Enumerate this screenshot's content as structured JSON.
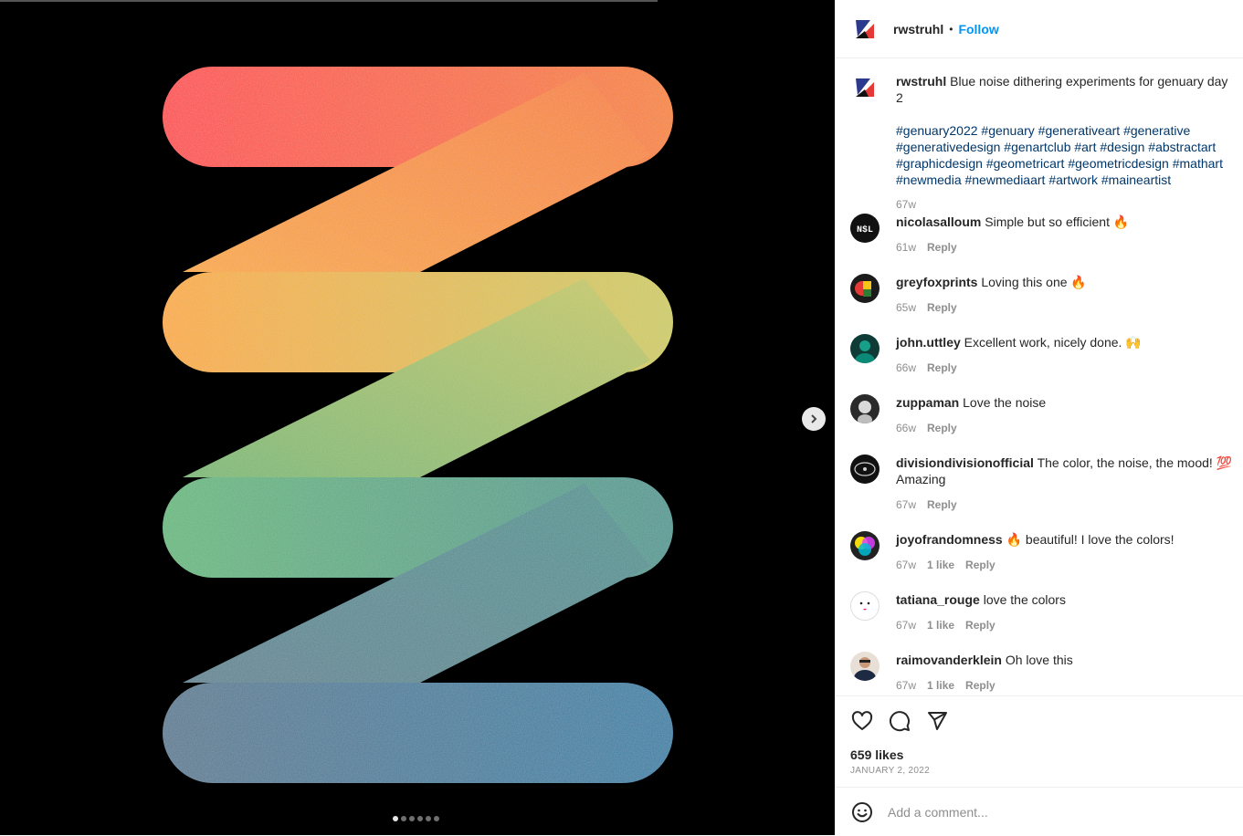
{
  "header": {
    "username": "rwstruhl",
    "separator": "•",
    "follow_label": "Follow"
  },
  "media": {
    "slide_count": 6,
    "active_slide": 0
  },
  "caption": {
    "username": "rwstruhl",
    "text": "Blue noise dithering experiments for genuary day 2",
    "hashtags": "#genuary2022 #genuary #generativeart #generative #generativedesign #genartclub #art #design #abstractart #graphicdesign #geometricart #geometricdesign #mathart #newmedia #newmediaart #artwork #maineartist",
    "time": "67w"
  },
  "comments": [
    {
      "username": "nicolasalloum",
      "text": "Simple but so efficient 🔥",
      "time": "61w",
      "likes": "",
      "reply": "Reply"
    },
    {
      "username": "greyfoxprints",
      "text": "Loving this one 🔥",
      "time": "65w",
      "likes": "",
      "reply": "Reply"
    },
    {
      "username": "john.uttley",
      "text": "Excellent work, nicely done. 🙌",
      "time": "66w",
      "likes": "",
      "reply": "Reply"
    },
    {
      "username": "zuppaman",
      "text": "Love the noise",
      "time": "66w",
      "likes": "",
      "reply": "Reply"
    },
    {
      "username": "divisiondivisionofficial",
      "text": "The color, the noise, the mood! 💯 Amazing",
      "time": "67w",
      "likes": "",
      "reply": "Reply"
    },
    {
      "username": "joyofrandomness",
      "text": "🔥 beautiful! I love the colors!",
      "time": "67w",
      "likes": "1 like",
      "reply": "Reply"
    },
    {
      "username": "tatiana_rouge",
      "text": "love the colors",
      "time": "67w",
      "likes": "1 like",
      "reply": "Reply"
    },
    {
      "username": "raimovanderklein",
      "text": "Oh love this",
      "time": "67w",
      "likes": "1 like",
      "reply": "Reply"
    }
  ],
  "footer": {
    "likes": "659 likes",
    "date": "JANUARY 2, 2022",
    "comment_placeholder": "Add a comment..."
  },
  "icons": {
    "like": "heart-icon",
    "comment": "comment-bubble-icon",
    "share": "paper-plane-icon",
    "emoji": "smiley-icon",
    "next": "chevron-right-icon"
  },
  "colors": {
    "accent": "#0095f6",
    "hashtag": "#00376b",
    "muted": "#8e8e8e",
    "text": "#262626"
  }
}
